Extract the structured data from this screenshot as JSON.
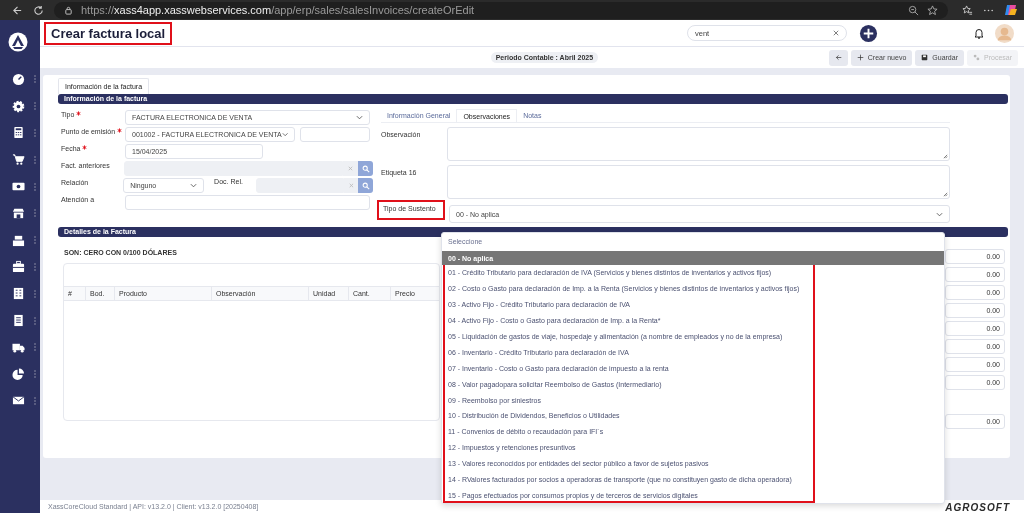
{
  "browser": {
    "scheme": "https://",
    "host": "xass4app.xasswebservices.com",
    "path": "/app/erp/sales/salesInvoices/createOrEdit"
  },
  "header": {
    "title": "Crear factura local",
    "title_highlighted": true,
    "search": {
      "value": "vent"
    }
  },
  "toolbar": {
    "period": "Periodo Contable : Abril 2025",
    "buttons": [
      {
        "kind": "back",
        "disabled": false
      },
      {
        "kind": "new",
        "label": "Crear nuevo",
        "disabled": false
      },
      {
        "kind": "save",
        "label": "Guardar",
        "disabled": false
      },
      {
        "kind": "process",
        "label": "Procesar",
        "disabled": true
      }
    ]
  },
  "page_tabs": [
    {
      "label": "Información de la factura",
      "selected": true
    }
  ],
  "section_title": "Información de la factura",
  "form": {
    "tipo": {
      "label": "Tipo",
      "required": true,
      "value": "FACTURA ELECTRONICA DE VENTA"
    },
    "punto": {
      "label": "Punto de emisión",
      "required": true,
      "value": "001002 - FACTURA ELECTRONICA DE VENTA"
    },
    "fecha": {
      "label": "Fecha",
      "required": true,
      "value": "15/04/2025"
    },
    "anteriores": {
      "label": "Fact. anteriores",
      "required": false
    },
    "relacion": {
      "label": "Relación",
      "required": false,
      "value": "Ninguno",
      "doc_label": "Doc. Rel."
    },
    "atencion": {
      "label": "Atención a",
      "required": false
    }
  },
  "detail_tabs": [
    {
      "label": "Información General",
      "selected": false
    },
    {
      "label": "Observaciones",
      "selected": true
    },
    {
      "label": "Notas",
      "selected": false
    }
  ],
  "observaciones": {
    "observacion_label": "Observación",
    "etiqueta_label": "Etiqueta 16",
    "sustento": {
      "label": "Tipo de Sustento",
      "highlighted": true,
      "value": "00 - No aplica"
    }
  },
  "details": {
    "title": "Detalles de la Factura",
    "amount_words": "SON: CERO CON 0/100 DÓLARES",
    "columns": [
      "#",
      "Bod.",
      "Producto",
      "Observación",
      "Unidad",
      "Cant.",
      "Precio"
    ],
    "totals": [
      "0.00",
      "0.00",
      "0.00",
      "0.00",
      "0.00",
      "0.00",
      "0.00",
      "0.00"
    ],
    "grand_total": "0.00"
  },
  "dropdown": {
    "placeholder": "Seleccione",
    "highlighted": true,
    "options": [
      {
        "label": "00 - No aplica",
        "selected": true
      },
      {
        "label": "01 - Crédito Tributario para declaración de IVA (Servicios y bienes distintos de inventarios y activos fijos)",
        "selected": false
      },
      {
        "label": "02 - Costo o Gasto para declaración de Imp. a la Renta (Servicios y bienes distintos de inventarios y activos fijos)",
        "selected": false
      },
      {
        "label": "03 - Activo Fijo - Crédito Tributario para declaración de IVA",
        "selected": false
      },
      {
        "label": "04 - Activo Fijo - Costo o Gasto para declaración de Imp. a la Renta*",
        "selected": false
      },
      {
        "label": "05 - Liquidación de gastos de viaje, hospedaje y alimentación (a nombre de empleados y no de la empresa)",
        "selected": false
      },
      {
        "label": "06 - Inventario - Crédito Tributario para declaración de IVA",
        "selected": false
      },
      {
        "label": "07 - Inventario - Costo o Gasto para declaración de impuesto a la renta",
        "selected": false
      },
      {
        "label": "08 - Valor pagadopara solicitar Reembolso de Gastos (Intermediario)",
        "selected": false
      },
      {
        "label": "09 - Reembolso por siniestros",
        "selected": false
      },
      {
        "label": "10 - Distribución de Dividendos, Beneficios o Utilidades",
        "selected": false
      },
      {
        "label": "11 - Convenios de débito o recaudación para IFI´s",
        "selected": false
      },
      {
        "label": "12 - Impuestos y retenciones presuntivos",
        "selected": false
      },
      {
        "label": "13 - Valores reconocidos por entidades del sector público a favor de sujetos pasivos",
        "selected": false
      },
      {
        "label": "14 - RValores facturados por socios a operadoras de transporte (que no constituyen gasto de dicha operadora)",
        "selected": false
      },
      {
        "label": "15 - Pagos efectuados por consumos propios y de terceros de servicios digitales",
        "selected": false
      }
    ]
  },
  "footer": {
    "version": "XassCoreCloud Standard | API: v13.2.0 | Client: v13.2.0 [20250408]",
    "brand": "AGROSOFT"
  }
}
